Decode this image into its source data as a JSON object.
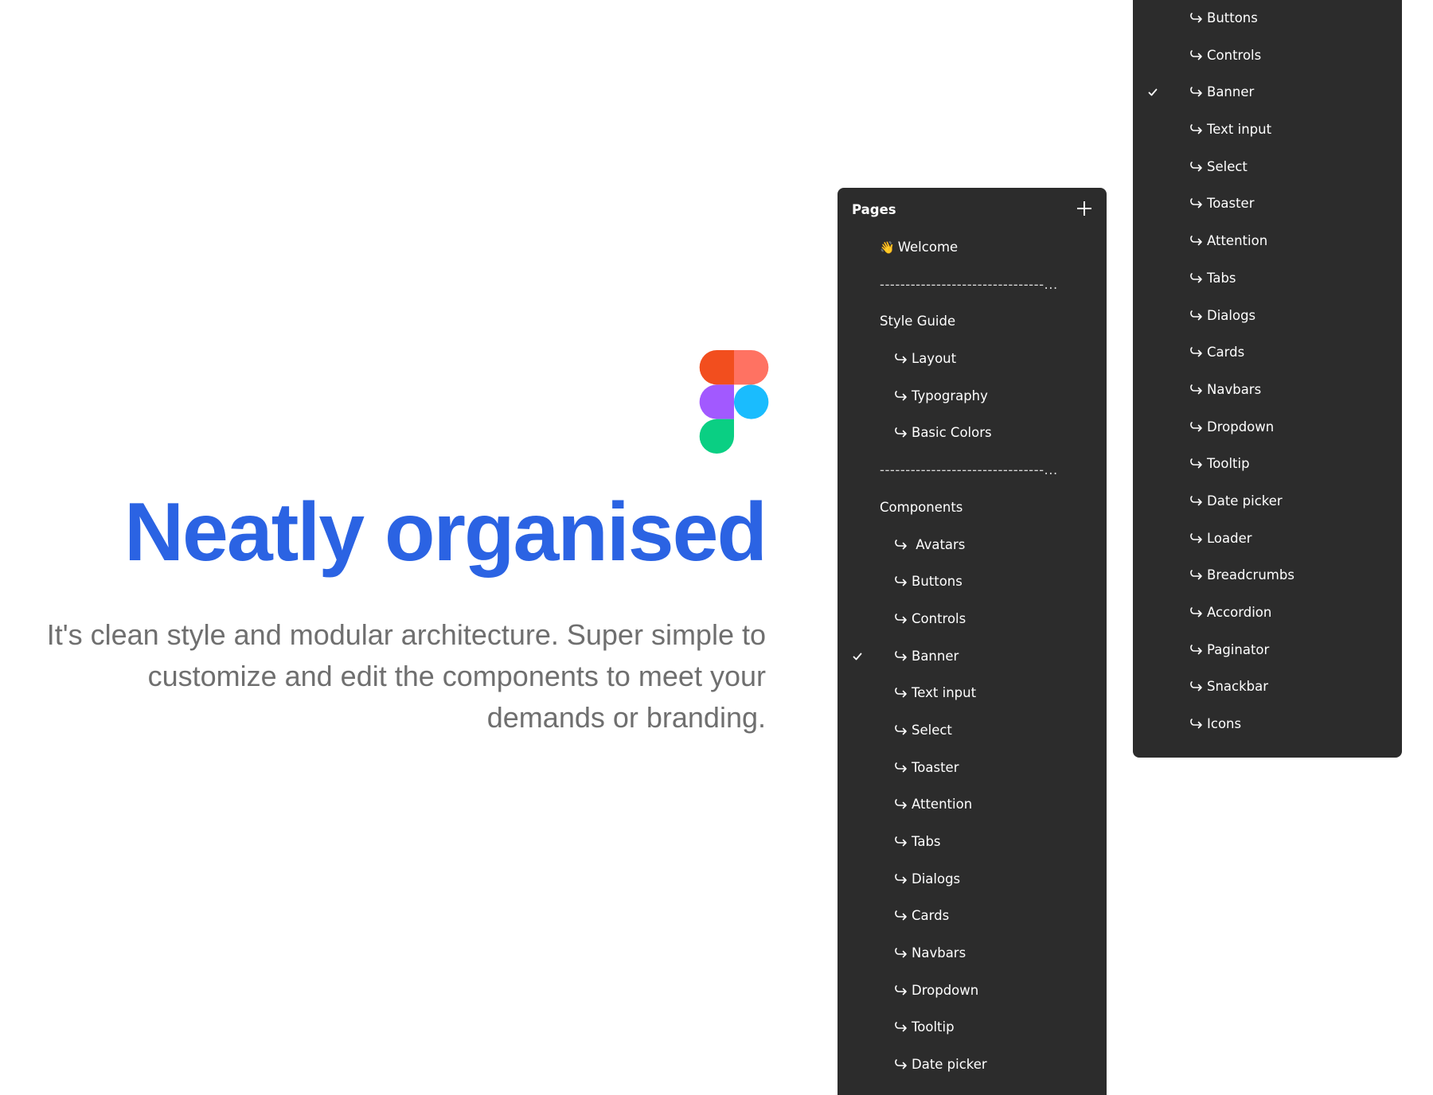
{
  "colors": {
    "headline": "#2b63e3",
    "subtext": "#6f6f6f",
    "panel_bg": "#2c2c2c",
    "logo_red": "#f24e1e",
    "logo_salmon": "#ff7262",
    "logo_purple": "#a259ff",
    "logo_blue": "#1abcfe",
    "logo_green": "#0acf83"
  },
  "hero": {
    "logo_icon": "figma-logo-icon",
    "headline": "Neatly organised",
    "description": "It's clean style and modular architecture. Super simple to customize and edit the components to meet your demands or branding."
  },
  "pages_panel": {
    "title": "Pages",
    "add_icon": "plus-icon",
    "items": [
      {
        "label": "Welcome",
        "level": 0,
        "icon": "waving-hand-icon"
      },
      {
        "label": "--------------------------------...",
        "level": 0,
        "type": "separator"
      },
      {
        "label": "Style Guide",
        "level": 0
      },
      {
        "label": "Layout",
        "level": 1
      },
      {
        "label": "Typography",
        "level": 1
      },
      {
        "label": "Basic Colors",
        "level": 1
      },
      {
        "label": "--------------------------------...",
        "level": 0,
        "type": "separator"
      },
      {
        "label": "Components",
        "level": 0
      },
      {
        "label": " Avatars",
        "level": 1
      },
      {
        "label": "Buttons",
        "level": 1
      },
      {
        "label": "Controls",
        "level": 1
      },
      {
        "label": "Banner",
        "level": 1,
        "selected": true
      },
      {
        "label": "Text input",
        "level": 1
      },
      {
        "label": "Select",
        "level": 1
      },
      {
        "label": "Toaster",
        "level": 1
      },
      {
        "label": "Attention",
        "level": 1
      },
      {
        "label": "Tabs",
        "level": 1
      },
      {
        "label": "Dialogs",
        "level": 1
      },
      {
        "label": "Cards",
        "level": 1
      },
      {
        "label": "Navbars",
        "level": 1
      },
      {
        "label": "Dropdown",
        "level": 1
      },
      {
        "label": "Tooltip",
        "level": 1
      },
      {
        "label": "Date picker",
        "level": 1
      }
    ]
  },
  "pages_panel_continued": {
    "items": [
      {
        "label": "Buttons",
        "level": 1
      },
      {
        "label": "Controls",
        "level": 1
      },
      {
        "label": "Banner",
        "level": 1,
        "selected": true
      },
      {
        "label": "Text input",
        "level": 1
      },
      {
        "label": "Select",
        "level": 1
      },
      {
        "label": "Toaster",
        "level": 1
      },
      {
        "label": "Attention",
        "level": 1
      },
      {
        "label": "Tabs",
        "level": 1
      },
      {
        "label": "Dialogs",
        "level": 1
      },
      {
        "label": "Cards",
        "level": 1
      },
      {
        "label": "Navbars",
        "level": 1
      },
      {
        "label": "Dropdown",
        "level": 1
      },
      {
        "label": "Tooltip",
        "level": 1
      },
      {
        "label": "Date picker",
        "level": 1
      },
      {
        "label": "Loader",
        "level": 1
      },
      {
        "label": "Breadcrumbs",
        "level": 1
      },
      {
        "label": "Accordion",
        "level": 1
      },
      {
        "label": "Paginator",
        "level": 1
      },
      {
        "label": "Snackbar",
        "level": 1
      },
      {
        "label": "Icons",
        "level": 1
      }
    ]
  }
}
